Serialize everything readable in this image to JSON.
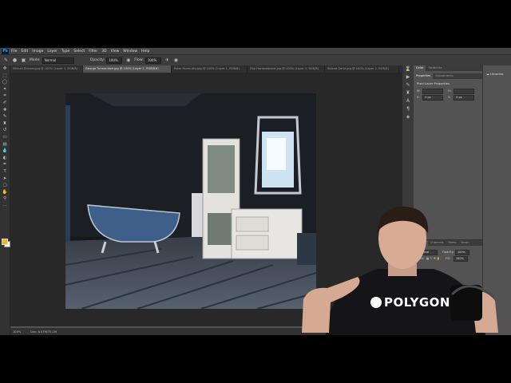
{
  "app": {
    "logo": "Ps"
  },
  "menu": [
    "File",
    "Edit",
    "Image",
    "Layer",
    "Type",
    "Select",
    "Filter",
    "3D",
    "View",
    "Window",
    "Help"
  ],
  "options": {
    "mode_label": "Mode:",
    "mode_value": "Normal",
    "opacity_label": "Opacity:",
    "opacity_value": "100%",
    "flow_label": "Flow:",
    "flow_value": "100%"
  },
  "tabs": [
    {
      "label": "Mikhail Zhirnov.jpg @ 100% (Layer 1, RGB/8)",
      "active": false
    },
    {
      "label": "George Turmanidze.jpg @ 100% (Layer 1, RGB/8#)",
      "active": true
    },
    {
      "label": "Peter Hurmuttly.jpg @ 100% (Layer 1, RGB/8)",
      "active": false
    },
    {
      "label": "Filip Harlandstone.jpg @ 100% (Layer 1, RGB/8)",
      "active": false
    },
    {
      "label": "Sidane Gertz.jpg @ 100% (Layer 1, RGB/8)",
      "active": false
    }
  ],
  "status": {
    "zoom": "100%",
    "doc": "Doc: 8.07M/75.1M"
  },
  "properties": {
    "tabs": [
      "Properties",
      "Adjustments"
    ],
    "top_tabs": [
      "Color",
      "Swatches"
    ],
    "title": "Pixel Layer Properties",
    "w_label": "W:",
    "w_value": "",
    "h_label": "H:",
    "h_value": "",
    "x_label": "X:",
    "x_value": "0 px",
    "y_label": "Y:",
    "y_value": "0 px"
  },
  "layers": {
    "tabs": [
      "Layers",
      "Channels",
      "Paths",
      "Brush"
    ],
    "blend_mode": "Normal",
    "opacity_label": "Opacity:",
    "opacity_value": "100%",
    "lock_label": "Lock:",
    "fill_label": "Fill:",
    "fill_value": "100%"
  },
  "libraries": {
    "label": "Libraries"
  },
  "overlay": {
    "brand_text": "POLYGON"
  },
  "colors": {
    "foreground": "#f5b21f",
    "background": "#ffffff",
    "ui_dark": "#535353"
  }
}
